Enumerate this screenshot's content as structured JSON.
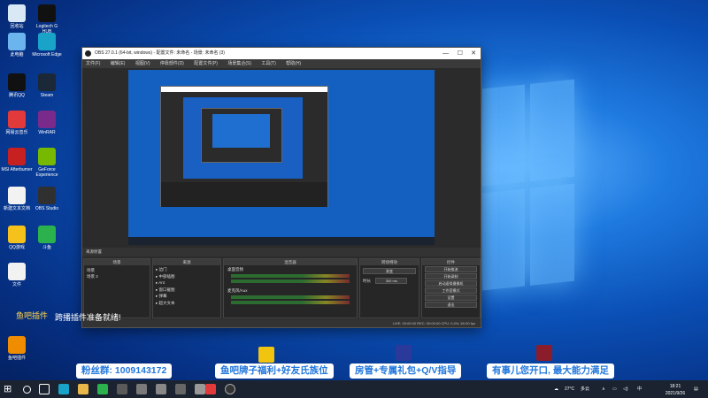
{
  "desktop": {
    "icons": [
      {
        "label": "回收站",
        "color": "#d9e8f5"
      },
      {
        "label": "Logitech G HUB",
        "color": "#111"
      },
      {
        "label": "此电脑",
        "color": "#6cb4ee"
      },
      {
        "label": "Microsoft Edge",
        "color": "#1aa3c8"
      },
      {
        "label": "腾讯QQ",
        "color": "#111"
      },
      {
        "label": "Steam",
        "color": "#1b2838"
      },
      {
        "label": "网易云音乐",
        "color": "#e23a3a"
      },
      {
        "label": "WinRAR",
        "color": "#7a2a8a"
      },
      {
        "label": "MSI Afterburner",
        "color": "#c62020"
      },
      {
        "label": "GeForce Experience",
        "color": "#76b900"
      },
      {
        "label": "新建文本文档",
        "color": "#f2f2f2"
      },
      {
        "label": "OBS Studio",
        "color": "#303030"
      },
      {
        "label": "QQ游戏",
        "color": "#f4c21a"
      },
      {
        "label": "斗鱼",
        "color": "#2bb24c"
      },
      {
        "label": "文件",
        "color": "#f2f2f2"
      },
      {
        "label": "鱼吧插件",
        "color": "#f08c00"
      }
    ]
  },
  "obs": {
    "title": "OBS 27.0.1 (64-bit, windows) - 配置文件: 未命名 - 场景: 未命名 (3)",
    "menu": [
      "文件(F)",
      "编辑(E)",
      "视图(V)",
      "停靠部件(D)",
      "配置文件(P)",
      "场景集合(S)",
      "工具(T)",
      "帮助(H)"
    ],
    "source_bar": "来源原置",
    "docks": {
      "scenes": {
        "title": "场景",
        "items": [
          "场景",
          "场景 2"
        ]
      },
      "sources": {
        "title": "来源",
        "items": [
          "边门",
          "中部插图",
          "Ant",
          "窗口截图",
          "弹幕",
          "超大文本"
        ]
      },
      "mixer": {
        "title": "混音器",
        "tracks": [
          {
            "name": "桌面音频",
            "level": "0.0 dB"
          },
          {
            "name": "麦克风/Aux",
            "level": "0.0 dB"
          }
        ]
      },
      "transitions": {
        "title": "转场特效",
        "type": "渐变",
        "duration_label": "时长",
        "duration": "300 ms"
      },
      "controls": {
        "title": "控件",
        "buttons": [
          "开始推流",
          "开始录制",
          "启动虚拟摄像机",
          "工作室模式",
          "设置",
          "退出"
        ]
      }
    },
    "status": "LIVE: 00:00:00   REC: 00:00:00   CPU: 0.4%, 60.00 fps"
  },
  "overlay": {
    "left_top": "鱼吧插件",
    "left_bottom": "跨播插件准备就绪!",
    "fans_group": "粉丝群: 1009143172",
    "mid1": "鱼吧牌子福利+好友氏族位",
    "mid2": "房管+专属礼包+Q/V指导",
    "right": "有事儿您开口, 最大能力满足"
  },
  "taskbar": {
    "weather": "27°C",
    "weather_desc": "多云",
    "ime": "中",
    "time": "18:21",
    "date": "2021/9/26"
  }
}
